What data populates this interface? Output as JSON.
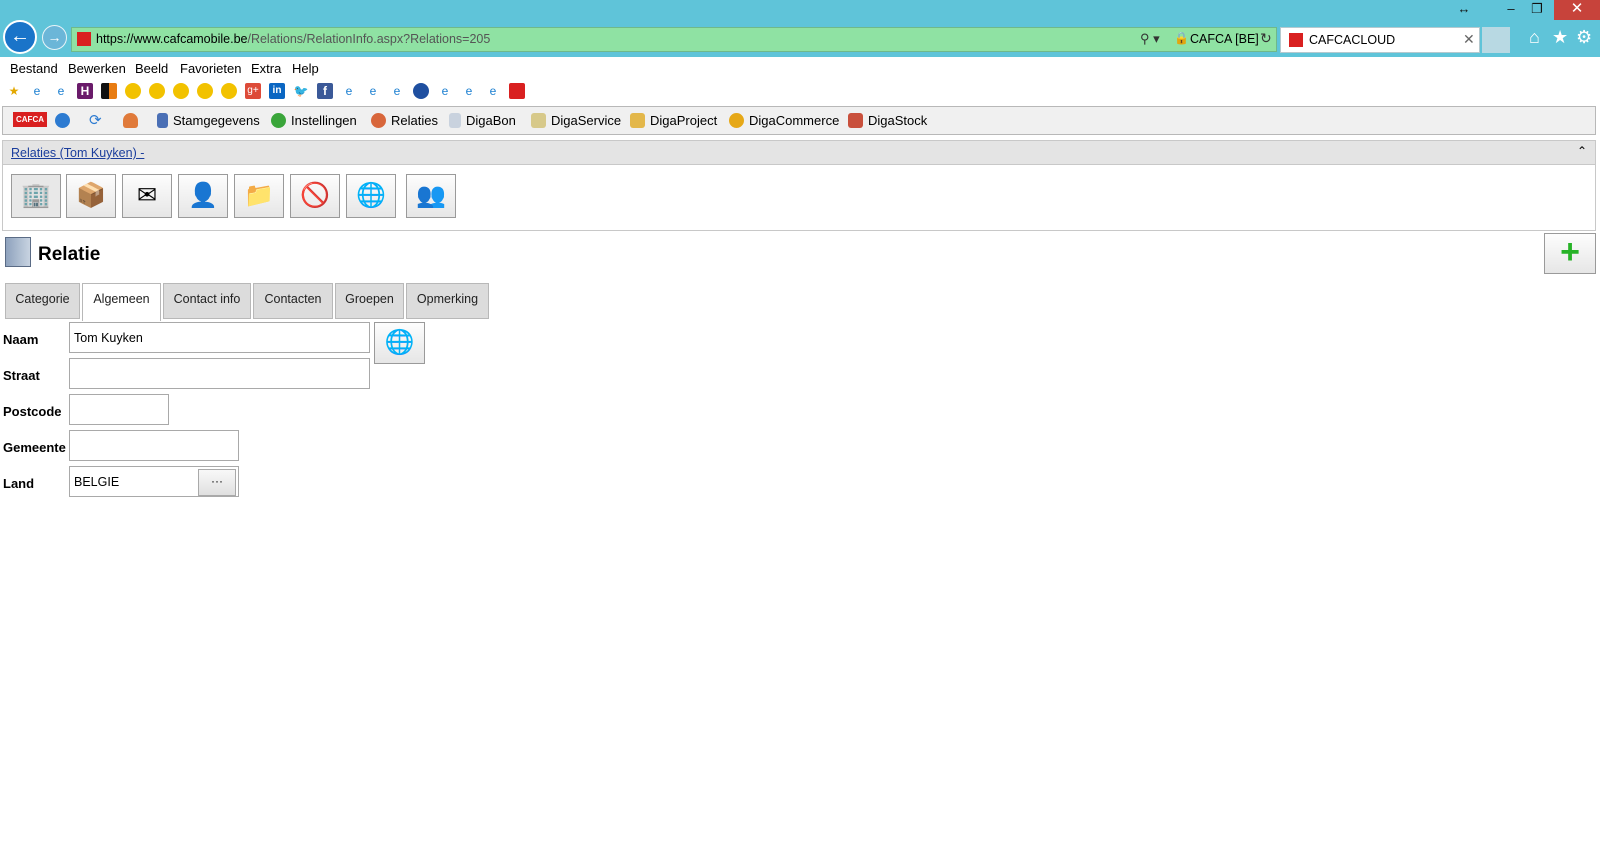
{
  "browser": {
    "url_prefix": "https://www.",
    "url_domain": "cafcamobile.be",
    "url_rest": "/Relations/RelationInfo.aspx?Relations=205",
    "cert_label": "CAFCA [BE]",
    "tab_title": "CAFCACLOUD",
    "window_controls": {
      "resize": "↔",
      "minimize": "–",
      "restore": "❐",
      "close": "✕"
    }
  },
  "menu": [
    "Bestand",
    "Bewerken",
    "Beeld",
    "Favorieten",
    "Extra",
    "Help"
  ],
  "app_toolbar": {
    "logo": "CAFCA",
    "items": [
      "Stamgegevens",
      "Instellingen",
      "Relaties",
      "DigaBon",
      "DigaService",
      "DigaProject",
      "DigaCommerce",
      "DigaStock"
    ]
  },
  "breadcrumb": "Relaties (Tom Kuyken) -",
  "page_title": "Relatie",
  "tabs": [
    "Categorie",
    "Algemeen",
    "Contact info",
    "Contacten",
    "Groepen",
    "Opmerking"
  ],
  "active_tab": "Algemeen",
  "form": {
    "naam_label": "Naam",
    "naam_value": "Tom Kuyken",
    "straat_label": "Straat",
    "straat_value": "",
    "postcode_label": "Postcode",
    "postcode_value": "",
    "gemeente_label": "Gemeente",
    "gemeente_value": "",
    "land_label": "Land",
    "land_value": "BELGIE",
    "land_button": "···"
  },
  "colors": {
    "titlebar": "#5fc4d9",
    "addressbar": "#8fe2a3",
    "close": "#c7433b",
    "link": "#1a3d9c",
    "add_green": "#27b327"
  }
}
